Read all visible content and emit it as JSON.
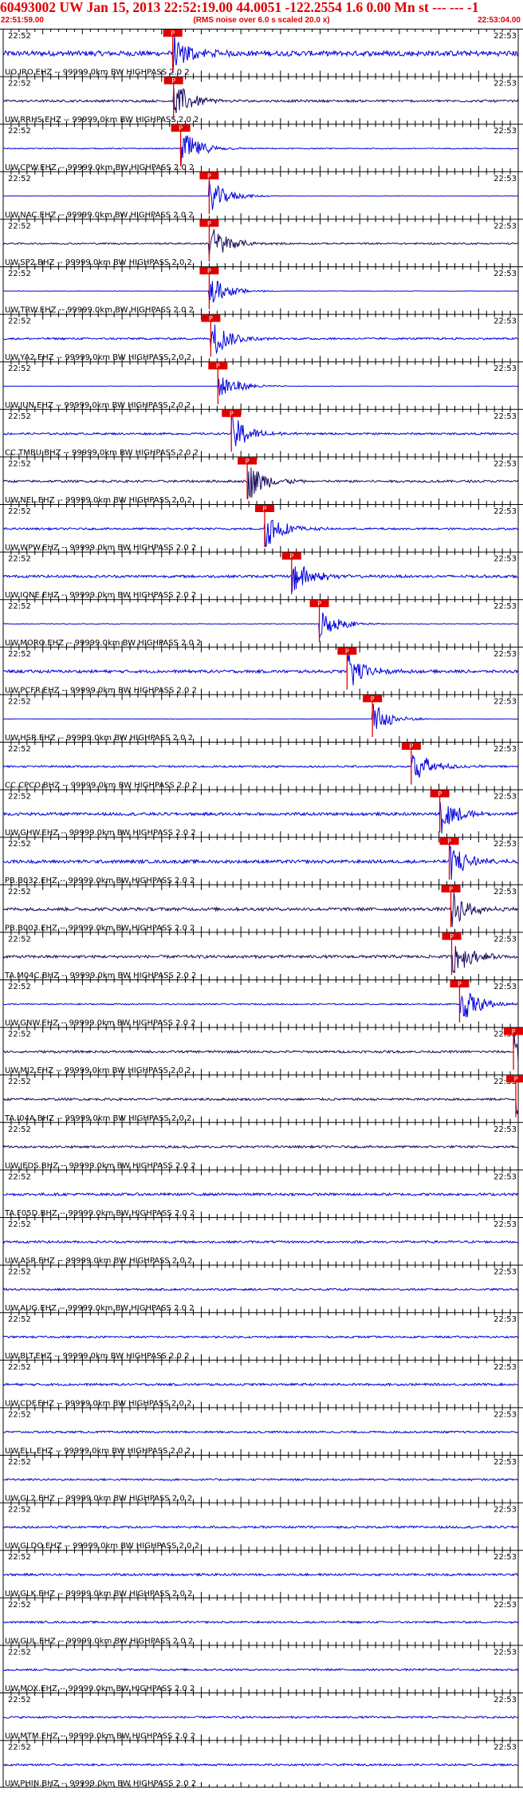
{
  "header": {
    "title": "60493002 UW Jan 15, 2013 22:52:19.00  44.0051 -122.2554  1.6 0.00 Mn st --- --- -1",
    "start_time": "22:51:59.00",
    "note": "(RMS noise over 6.0 s scaled 20.0 x)",
    "end_time": "22:53:04.00"
  },
  "chart_data": {
    "type": "line",
    "title": "60493002 UW Jan 15, 2013 22:52:19.00  44.0051 -122.2554  1.6 0.00 Mn st --- --- -1",
    "x_range": [
      "22:51:59.00",
      "22:53:04.00"
    ],
    "minute_labels": [
      "22:52",
      "22:53"
    ],
    "pick_label": "P",
    "colors": {
      "trace_blue": "#0000dd",
      "trace_dark": "#1a0a5e",
      "pick": "#e00000",
      "axis": "#000000"
    },
    "traces": [
      {
        "label": "UO.IRO.EHZ -- 99999.0km BW  HIGHPASS  2.0  2",
        "pick_s": 21.4,
        "color": "blue",
        "noise": 0.8
      },
      {
        "label": "UW.RRHS.EHZ -- 99999.0km BW  HIGHPASS  2.0  2",
        "pick_s": 21.5,
        "color": "dark",
        "noise": 0.35
      },
      {
        "label": "UW.CPW.EHZ -- 99999.0km BW  HIGHPASS  2.0  2",
        "pick_s": 22.4,
        "color": "blue",
        "noise": 0.15
      },
      {
        "label": "UW.NAC.EHZ -- 99999.0km BW  HIGHPASS  2.0  2",
        "pick_s": 26.0,
        "color": "blue",
        "noise": 0.05
      },
      {
        "label": "UW.SP2.BHZ -- 99999.0km BW  HIGHPASS  2.0  2",
        "pick_s": 26.0,
        "color": "dark",
        "noise": 0.25
      },
      {
        "label": "UW.TRW.EHZ -- 99999.0km BW  HIGHPASS  2.0  2",
        "pick_s": 26.0,
        "color": "blue",
        "noise": 0.05
      },
      {
        "label": "UW.YA2.EHZ -- 99999.0km BW  HIGHPASS  2.0  2",
        "pick_s": 26.2,
        "color": "blue",
        "noise": 0.3
      },
      {
        "label": "UW.JUN.EHZ -- 99999.0km BW  HIGHPASS  2.0  2",
        "pick_s": 27.1,
        "color": "blue",
        "noise": 0.05
      },
      {
        "label": "CC.TMBU.BHZ -- 99999.0km BW  HIGHPASS  2.0  2",
        "pick_s": 28.8,
        "color": "blue",
        "noise": 0.3
      },
      {
        "label": "UW.NEL.EHZ -- 99999.0km BW  HIGHPASS  2.0  2",
        "pick_s": 30.8,
        "color": "dark",
        "noise": 0.35
      },
      {
        "label": "UW.WPW.EHZ -- 99999.0km BW  HIGHPASS  2.0  2",
        "pick_s": 33.0,
        "color": "blue",
        "noise": 0.3
      },
      {
        "label": "UW.IONE.EHZ -- 99999.0km BW  HIGHPASS  2.0  2",
        "pick_s": 36.4,
        "color": "blue",
        "noise": 0.4
      },
      {
        "label": "UW.MORO.EHZ -- 99999.0km BW  HIGHPASS  2.0  2",
        "pick_s": 39.9,
        "color": "blue",
        "noise": 0.1
      },
      {
        "label": "UW.PCFR.EHZ -- 99999.0km BW  HIGHPASS  2.0  2",
        "pick_s": 43.4,
        "color": "blue",
        "noise": 0.45
      },
      {
        "label": "UW.HSR.EHZ -- 99999.0km BW  HIGHPASS  2.0  2",
        "pick_s": 46.6,
        "color": "blue",
        "noise": 0.05
      },
      {
        "label": "CC.CPCO.BHZ -- 99999.0km BW  HIGHPASS  2.0  2",
        "pick_s": 51.5,
        "color": "blue",
        "noise": 0.3
      },
      {
        "label": "UW.GHW.EHZ -- 99999.0km BW  HIGHPASS  2.0  2",
        "pick_s": 55.1,
        "color": "blue",
        "noise": 0.45
      },
      {
        "label": "PB.B032.EHZ -- 99999.0km BW  HIGHPASS  2.0  2",
        "pick_s": 56.3,
        "color": "blue",
        "noise": 0.5
      },
      {
        "label": "PB.B003.EHZ -- 99999.0km BW  HIGHPASS  2.0  2",
        "pick_s": 56.5,
        "color": "dark",
        "noise": 0.5
      },
      {
        "label": "TA.M04C.BHZ -- 99999.0km BW  HIGHPASS  2.0  2",
        "pick_s": 56.6,
        "color": "dark",
        "noise": 0.45
      },
      {
        "label": "UW.GNW.EHZ -- 99999.0km BW  HIGHPASS  2.0  2",
        "pick_s": 57.6,
        "color": "blue",
        "noise": 0.2
      },
      {
        "label": "UW.MJ2.EHZ -- 99999.0km BW  HIGHPASS  2.0  2",
        "pick_s": 64.4,
        "color": "dark",
        "noise": 0.35
      },
      {
        "label": "TA.I04A.BHZ -- 99999.0km BW  HIGHPASS  2.0  2",
        "pick_s": 64.7,
        "color": "dark",
        "noise": 0.35
      },
      {
        "label": "UW.JEDS.BHZ -- 99999.0km BW  HIGHPASS  2.0  2",
        "pick_s": null,
        "color": "dark",
        "noise": 0.35
      },
      {
        "label": "TA.F05D.BHZ -- 99999.0km BW  HIGHPASS  2.0  2",
        "pick_s": null,
        "color": "blue",
        "noise": 0.4
      },
      {
        "label": "UW.ASR.EHZ -- 99999.0km BW  HIGHPASS  2.0  2",
        "pick_s": null,
        "color": "blue",
        "noise": 0.35
      },
      {
        "label": "UW.AUG.EHZ -- 99999.0km BW  HIGHPASS  2.0  2",
        "pick_s": null,
        "color": "blue",
        "noise": 0.3
      },
      {
        "label": "UW.BLT.EHZ -- 99999.0km BW  HIGHPASS  2.0  2",
        "pick_s": null,
        "color": "blue",
        "noise": 0.3
      },
      {
        "label": "UW.CDF.EHZ -- 99999.0km BW  HIGHPASS  2.0  2",
        "pick_s": null,
        "color": "blue",
        "noise": 0.35
      },
      {
        "label": "UW.ELL.EHZ -- 99999.0km BW  HIGHPASS  2.0  2",
        "pick_s": null,
        "color": "blue",
        "noise": 0.3
      },
      {
        "label": "UW.GL2.EHZ -- 99999.0km BW  HIGHPASS  2.0  2",
        "pick_s": null,
        "color": "blue",
        "noise": 0.3
      },
      {
        "label": "UW.GLDO.EHZ -- 99999.0km BW  HIGHPASS  2.0  2",
        "pick_s": null,
        "color": "blue",
        "noise": 0.35
      },
      {
        "label": "UW.GLK.EHZ -- 99999.0km BW  HIGHPASS  2.0  2",
        "pick_s": null,
        "color": "blue",
        "noise": 0.35
      },
      {
        "label": "UW.GUL.EHZ -- 99999.0km BW  HIGHPASS  2.0  2",
        "pick_s": null,
        "color": "blue",
        "noise": 0.3
      },
      {
        "label": "UW.MOX.EHZ -- 99999.0km BW  HIGHPASS  2.0  2",
        "pick_s": null,
        "color": "blue",
        "noise": 0.3
      },
      {
        "label": "UW.MTM.EHZ -- 99999.0km BW  HIGHPASS  2.0  2",
        "pick_s": null,
        "color": "blue",
        "noise": 0.3
      },
      {
        "label": "UW.PHIN.BHZ -- 99999.0km BW  HIGHPASS  2.0  2",
        "pick_s": null,
        "color": "blue",
        "noise": 0.3
      }
    ]
  }
}
